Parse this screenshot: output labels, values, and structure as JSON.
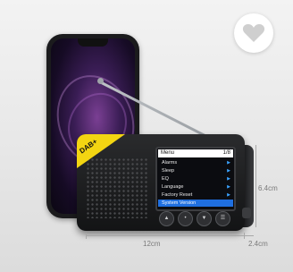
{
  "favorite": {
    "icon": "heart-icon"
  },
  "display": {
    "title": "Menu",
    "page": "1/8",
    "items": [
      {
        "label": "Alarms"
      },
      {
        "label": "Sleep"
      },
      {
        "label": "EQ"
      },
      {
        "label": "Language"
      },
      {
        "label": "Factory Reset"
      },
      {
        "label": "System Version"
      }
    ],
    "selected_index": 5
  },
  "badge": {
    "text": "DAB+"
  },
  "dimensions": {
    "width": "12cm",
    "height": "6.4cm",
    "depth": "2.4cm"
  },
  "colors": {
    "badge": "#f3d512",
    "selection": "#1f6fe0",
    "device": "#1b1b1d"
  }
}
